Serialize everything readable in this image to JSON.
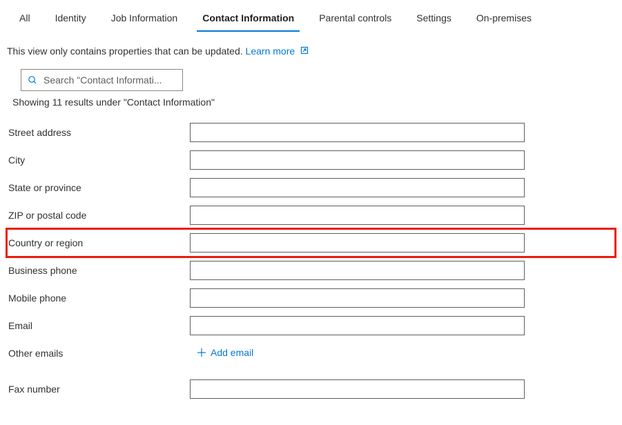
{
  "tabs": [
    {
      "label": "All"
    },
    {
      "label": "Identity"
    },
    {
      "label": "Job Information"
    },
    {
      "label": "Contact Information"
    },
    {
      "label": "Parental controls"
    },
    {
      "label": "Settings"
    },
    {
      "label": "On-premises"
    }
  ],
  "hint": {
    "text": "This view only contains properties that can be updated. ",
    "link": "Learn more"
  },
  "search": {
    "placeholder": "Search \"Contact Informati..."
  },
  "results_text": "Showing 11 results under \"Contact Information\"",
  "fields": {
    "street_address": {
      "label": "Street address",
      "value": ""
    },
    "city": {
      "label": "City",
      "value": ""
    },
    "state": {
      "label": "State or province",
      "value": ""
    },
    "zip": {
      "label": "ZIP or postal code",
      "value": ""
    },
    "country": {
      "label": "Country or region",
      "value": ""
    },
    "business_phone": {
      "label": "Business phone",
      "value": ""
    },
    "mobile_phone": {
      "label": "Mobile phone",
      "value": ""
    },
    "email": {
      "label": "Email",
      "value": ""
    },
    "other_emails": {
      "label": "Other emails"
    },
    "fax": {
      "label": "Fax number",
      "value": ""
    }
  },
  "add_email_label": "Add email"
}
